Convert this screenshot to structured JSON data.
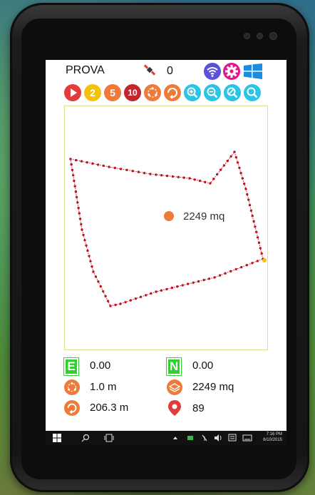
{
  "app": {
    "title": "PROVA",
    "satellite_count": "0"
  },
  "icons": {
    "header": [
      "satellite-icon",
      "wifi-icon",
      "gear-icon",
      "windows-logo-icon"
    ],
    "toolbar": [
      "play-icon",
      "measure-2-icon",
      "measure-5-icon",
      "measure-10-icon",
      "perimeter-points-icon",
      "polygon-rotate-icon",
      "zoom-in-icon",
      "zoom-out-icon",
      "zoom-fit-icon",
      "zoom-search-icon"
    ]
  },
  "toolbar": {
    "btn2_label": "2",
    "btn5_label": "5",
    "btn10_label": "10"
  },
  "map": {
    "area_label": "2249 mq"
  },
  "readouts": {
    "e_badge": "E",
    "e_value": "0.00",
    "n_badge": "N",
    "n_value": "0.00",
    "spacing_value": "1.0 m",
    "area_value": "2249 mq",
    "perimeter_value": "206.3 m",
    "points_value": "89"
  },
  "taskbar": {
    "time": "7:16 PM",
    "date": "6/10/2015"
  },
  "colors": {
    "polygon": "#c1121f",
    "green_badge": "#2fd12f",
    "orange": "#ee7b3a",
    "red": "#e23b3b",
    "cyan": "#29c4e6",
    "yellow": "#f4c20d",
    "purple": "#5a52d6",
    "magenta": "#e1178a",
    "windows_blue": "#1b8de0"
  }
}
